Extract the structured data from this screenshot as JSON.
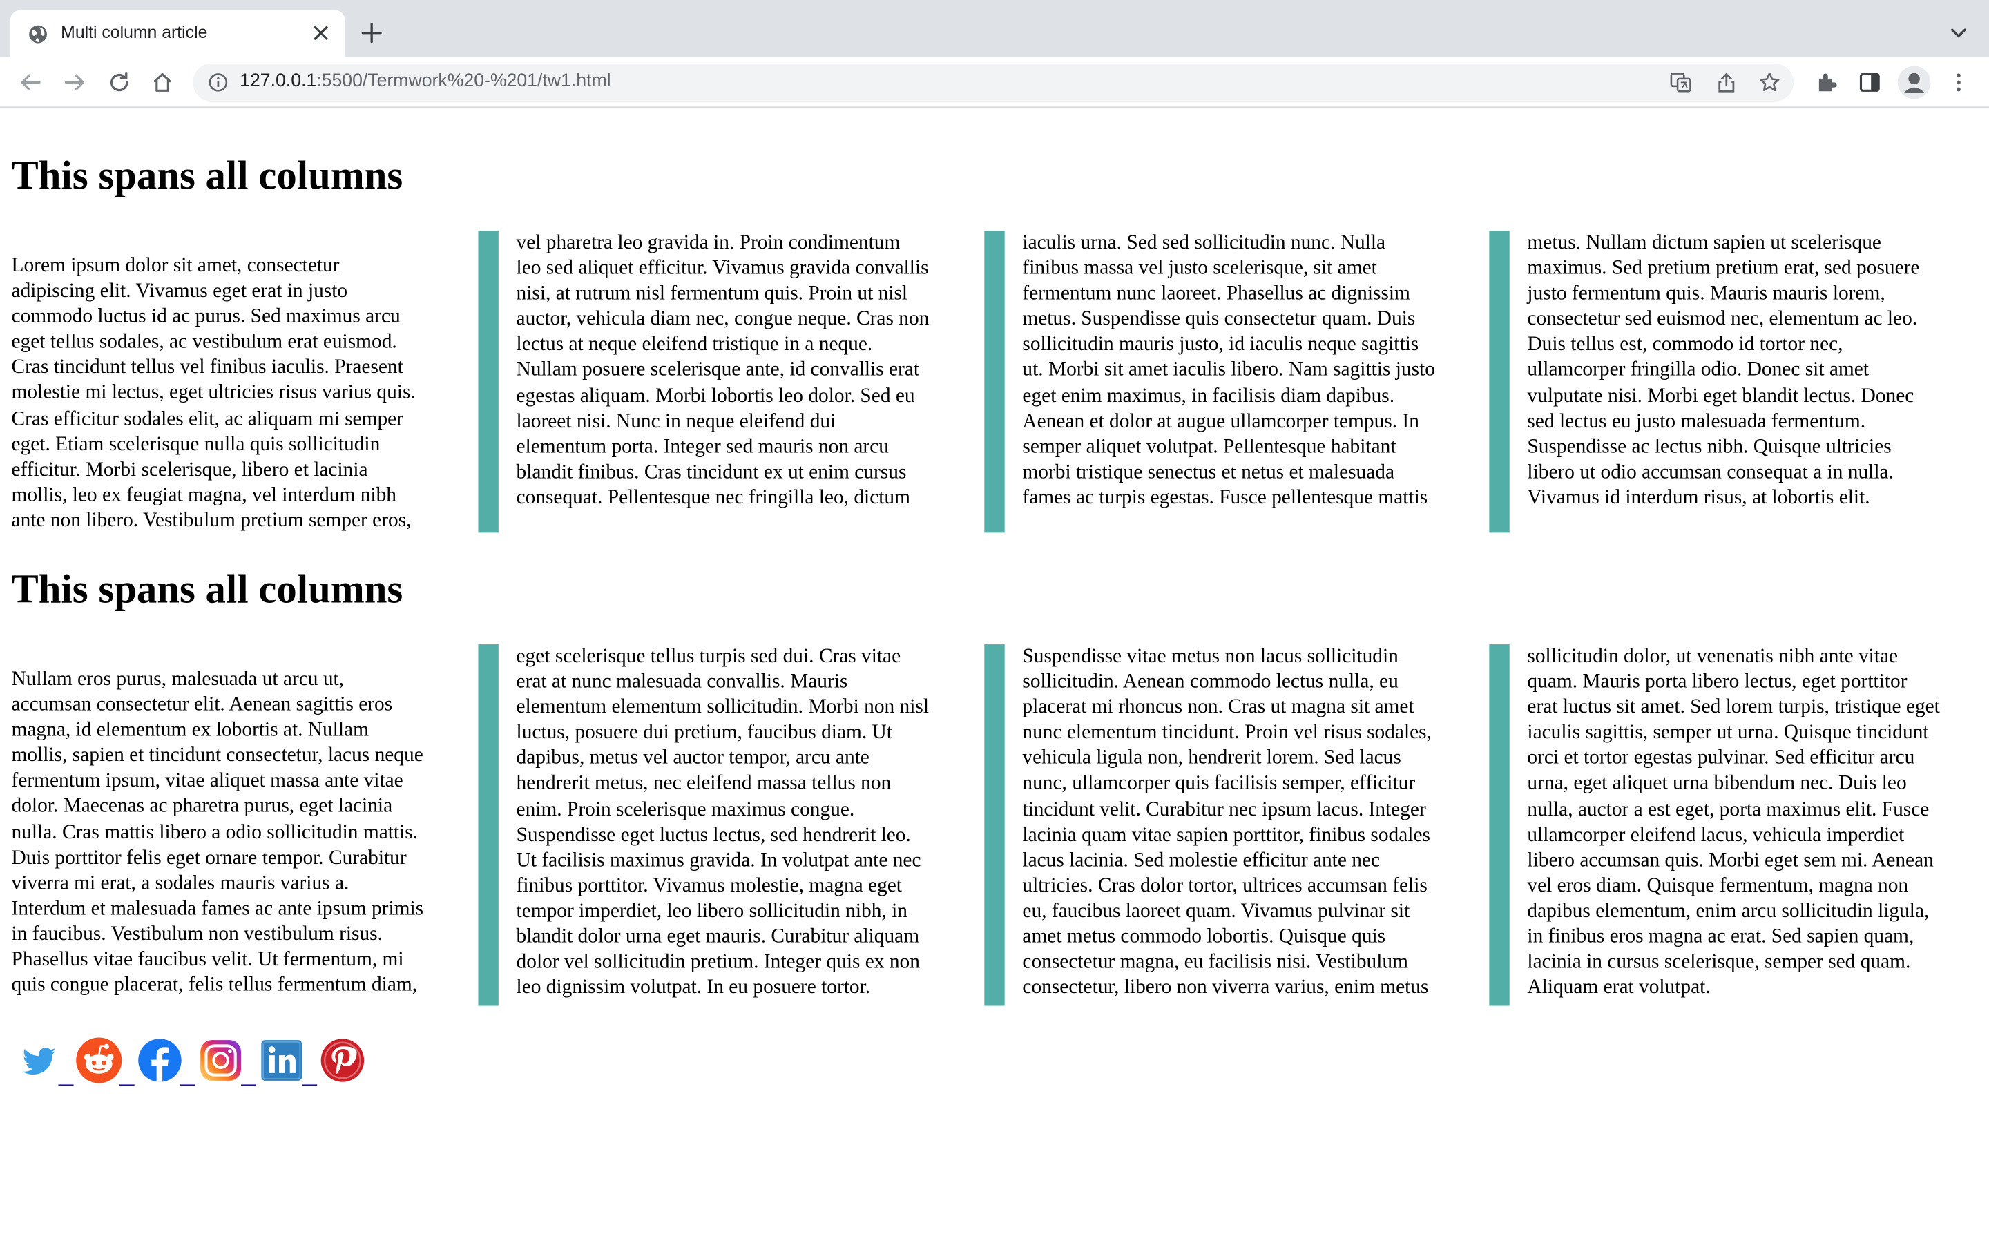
{
  "browser": {
    "tab_title": "Multi column article",
    "url_host": "127.0.0.1",
    "url_rest": ":5500/Termwork%20-%201/tw1.html"
  },
  "sections": [
    {
      "heading": "This spans all columns",
      "columns": [
        [
          "Lorem ipsum dolor sit amet, consectetur",
          "adipiscing elit. Vivamus eget erat in justo",
          "commodo luctus id ac purus. Sed maximus arcu",
          "eget tellus sodales, ac vestibulum erat euismod.",
          "Cras tincidunt tellus vel finibus iaculis. Praesent",
          "molestie mi lectus, eget ultricies risus varius quis.",
          "Cras efficitur sodales elit, ac aliquam mi semper",
          "eget. Etiam scelerisque nulla quis sollicitudin",
          "efficitur. Morbi scelerisque, libero et lacinia",
          "mollis, leo ex feugiat magna, vel interdum nibh",
          "ante non libero. Vestibulum pretium semper eros,"
        ],
        [
          "vel pharetra leo gravida in. Proin condimentum",
          "leo sed aliquet efficitur. Vivamus gravida convallis",
          "nisi, at rutrum nisl fermentum quis. Proin ut nisl",
          "auctor, vehicula diam nec, congue neque. Cras non",
          "lectus at neque eleifend tristique in a neque.",
          "Nullam posuere scelerisque ante, id convallis erat",
          "egestas aliquam. Morbi lobortis leo dolor. Sed eu",
          "laoreet nisi. Nunc in neque eleifend dui",
          "elementum porta. Integer sed mauris non arcu",
          "blandit finibus. Cras tincidunt ex ut enim cursus",
          "consequat. Pellentesque nec fringilla leo, dictum"
        ],
        [
          "iaculis urna. Sed sed sollicitudin nunc. Nulla",
          "finibus massa vel justo scelerisque, sit amet",
          "fermentum nunc laoreet. Phasellus ac dignissim",
          "metus. Suspendisse quis consectetur quam. Duis",
          "sollicitudin mauris justo, id iaculis neque sagittis",
          "ut. Morbi sit amet iaculis libero. Nam sagittis justo",
          "eget enim maximus, in facilisis diam dapibus.",
          "Aenean et dolor at augue ullamcorper tempus. In",
          "semper aliquet volutpat. Pellentesque habitant",
          "morbi tristique senectus et netus et malesuada",
          "fames ac turpis egestas. Fusce pellentesque mattis"
        ],
        [
          "metus. Nullam dictum sapien ut scelerisque",
          "maximus. Sed pretium pretium erat, sed posuere",
          "justo fermentum quis. Mauris mauris lorem,",
          "consectetur sed euismod nec, elementum ac leo.",
          "Duis tellus est, commodo id tortor nec,",
          "ullamcorper fringilla odio. Donec sit amet",
          "vulputate nisi. Morbi eget blandit lectus. Donec",
          "sed lectus eu justo malesuada fermentum.",
          "Suspendisse ac lectus nibh. Quisque ultricies",
          "libero ut odio accumsan consequat a in nulla.",
          "Vivamus id interdum risus, at lobortis elit."
        ]
      ]
    },
    {
      "heading": "This spans all columns",
      "columns": [
        [
          "Nullam eros purus, malesuada ut arcu ut,",
          "accumsan consectetur elit. Aenean sagittis eros",
          "magna, id elementum ex lobortis at. Nullam",
          "mollis, sapien et tincidunt consectetur, lacus neque",
          "fermentum ipsum, vitae aliquet massa ante vitae",
          "dolor. Maecenas ac pharetra purus, eget lacinia",
          "nulla. Cras mattis libero a odio sollicitudin mattis.",
          "Duis porttitor felis eget ornare tempor. Curabitur",
          "viverra mi erat, a sodales mauris varius a.",
          "Interdum et malesuada fames ac ante ipsum primis",
          "in faucibus. Vestibulum non vestibulum risus.",
          "Phasellus vitae faucibus velit. Ut fermentum, mi",
          "quis congue placerat, felis tellus fermentum diam,"
        ],
        [
          "eget scelerisque tellus turpis sed dui. Cras vitae",
          "erat at nunc malesuada convallis. Mauris",
          "elementum elementum sollicitudin. Morbi non nisl",
          "luctus, posuere dui pretium, faucibus diam. Ut",
          "dapibus, metus vel auctor tempor, arcu ante",
          "hendrerit metus, nec eleifend massa tellus non",
          "enim. Proin scelerisque maximus congue.",
          "Suspendisse eget luctus lectus, sed hendrerit leo.",
          "Ut facilisis maximus gravida. In volutpat ante nec",
          "finibus porttitor. Vivamus molestie, magna eget",
          "tempor imperdiet, leo libero sollicitudin nibh, in",
          "blandit dolor urna eget mauris. Curabitur aliquam",
          "dolor vel sollicitudin pretium. Integer quis ex non",
          "leo dignissim volutpat. In eu posuere tortor."
        ],
        [
          "Suspendisse vitae metus non lacus sollicitudin",
          "sollicitudin. Aenean commodo lectus nulla, eu",
          "placerat mi rhoncus non. Cras ut magna sit amet",
          "nunc elementum tincidunt. Proin vel risus sodales,",
          "vehicula ligula non, hendrerit lorem. Sed lacus",
          "nunc, ullamcorper quis facilisis semper, efficitur",
          "tincidunt velit. Curabitur nec ipsum lacus. Integer",
          "lacinia quam vitae sapien porttitor, finibus sodales",
          "lacus lacinia. Sed molestie efficitur ante nec",
          "ultricies. Cras dolor tortor, ultrices accumsan felis",
          "eu, faucibus laoreet quam. Vivamus pulvinar sit",
          "amet metus commodo lobortis. Quisque quis",
          "consectetur magna, eu facilisis nisi. Vestibulum",
          "consectetur, libero non viverra varius, enim metus"
        ],
        [
          "sollicitudin dolor, ut venenatis nibh ante vitae",
          "quam. Mauris porta libero lectus, eget porttitor",
          "erat luctus sit amet. Sed lorem turpis, tristique eget",
          "iaculis sagittis, semper ut urna. Quisque tincidunt",
          "orci et tortor egestas pulvinar. Sed efficitur arcu",
          "urna, eget aliquet urna bibendum nec. Duis leo",
          "nulla, auctor a est eget, porta maximus elit. Fusce",
          "ullamcorper eleifend lacus, vehicula imperdiet",
          "libero accumsan quis. Morbi eget sem mi. Aenean",
          "vel eros diam. Quisque fermentum, magna non",
          "dapibus elementum, enim arcu sollicitudin ligula,",
          "in finibus eros magna ac erat. Sed sapien quam,",
          "lacinia in cursus scelerisque, semper sed quam.",
          "Aliquam erat volutpat."
        ]
      ]
    }
  ],
  "social_icons": [
    "twitter-icon",
    "reddit-icon",
    "facebook-icon",
    "instagram-icon",
    "linkedin-icon",
    "pinterest-icon"
  ],
  "colors": {
    "column_rule": "#52aea7",
    "tab_strip": "#dee1e6",
    "omnibox": "#f1f3f4"
  }
}
